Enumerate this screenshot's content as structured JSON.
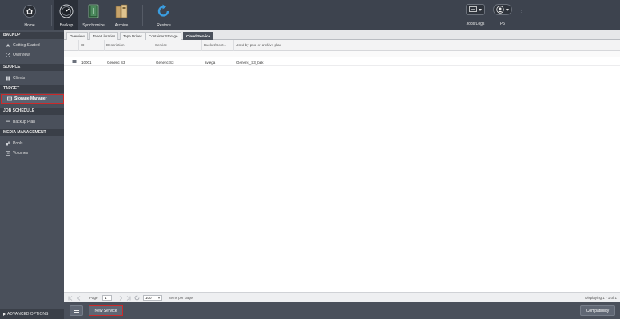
{
  "topnav": {
    "items": [
      {
        "label": "Home",
        "icon": "home-icon"
      },
      {
        "label": "Backup",
        "icon": "backup-gauge-icon"
      },
      {
        "label": "Synchronize",
        "icon": "synchronize-icon"
      },
      {
        "label": "Archive",
        "icon": "archive-icon"
      },
      {
        "label": "Restore",
        "icon": "restore-icon"
      }
    ],
    "jobs_logs_label": "Jobs/Logs",
    "user_label": "P5"
  },
  "sidebar": {
    "backup_header": "BACKUP",
    "getting_started": "Getting Started",
    "overview": "Overview",
    "source_header": "SOURCE",
    "clients": "Clients",
    "target_header": "TARGET",
    "storage_manager": "Storage Manager",
    "job_schedule_header": "JOB SCHEDULE",
    "backup_plan": "Backup Plan",
    "media_header": "MEDIA MANAGEMENT",
    "pools": "Pools",
    "volumes": "Volumes",
    "advanced_options": "ADVANCED OPTIONS"
  },
  "tabs": [
    "Overview",
    "Tape Libraries",
    "Tape Drives",
    "Container Storage",
    "Cloud Service"
  ],
  "grid": {
    "columns": [
      "ID",
      "Description",
      "Service",
      "Bucket/Cont...",
      "Used by pool or archive plan"
    ],
    "rows": [
      {
        "id": "10001",
        "description": "Generic S3",
        "service": "Generic S3",
        "bucket": "aviega",
        "used_by": "Generic_S3_bak"
      }
    ]
  },
  "pager": {
    "page_label": "Page",
    "page_value": "1",
    "per_page_value": "100",
    "items_per_page_label": "Items per page",
    "displaying": "Displaying 1 - 1 of 1"
  },
  "bottom": {
    "new_service": "New Service",
    "compatibility": "Compatibility"
  },
  "colors": {
    "topbar": "#3d434e",
    "sidebar": "#4a505b",
    "highlight": "#cc2a2a",
    "restore_accent": "#3a9de0"
  }
}
